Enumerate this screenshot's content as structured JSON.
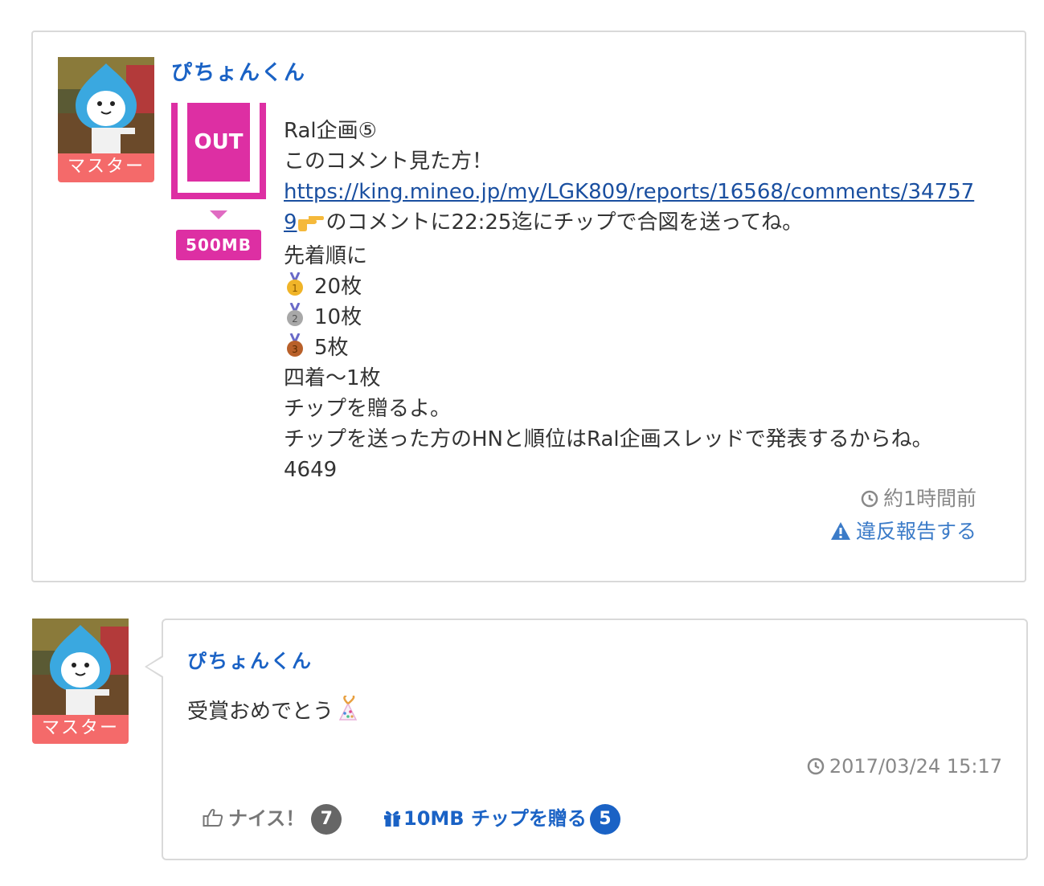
{
  "post": {
    "username": "ぴちょんくん",
    "role_badge": "マスター",
    "direction_label": "OUT",
    "tip_amount": "500MB",
    "lines": {
      "l1": "Ral企画⑤",
      "l2": "このコメント見た方！",
      "link_part1": "https://king.mineo.jp/my/LGK809/reports/16568/comments/34757",
      "link_part2": "9",
      "l4_rest": "のコメントに22:25迄にチップで合図を送ってね。",
      "l5": "先着順に",
      "gold": "20枚",
      "silver": "10枚",
      "bronze": "5枚",
      "l9": "四着〜1枚",
      "l10": "チップを贈るよ。",
      "l11": "チップを送った方のHNと順位はRal企画スレッドで発表するからね。",
      "l12": "4649"
    },
    "time": "約1時間前",
    "report": "違反報告する"
  },
  "comment": {
    "username": "ぴちょんくん",
    "role_badge": "マスター",
    "text": "受賞おめでとう",
    "time": "2017/03/24 15:17",
    "nice_label": "ナイス！",
    "nice_count": "7",
    "tip_label": "10MB チップを贈る",
    "tip_count": "5"
  },
  "colors": {
    "accent_blue": "#1a62c5",
    "out_pink": "#dd2fa3",
    "master_badge": "#f46a6a"
  }
}
